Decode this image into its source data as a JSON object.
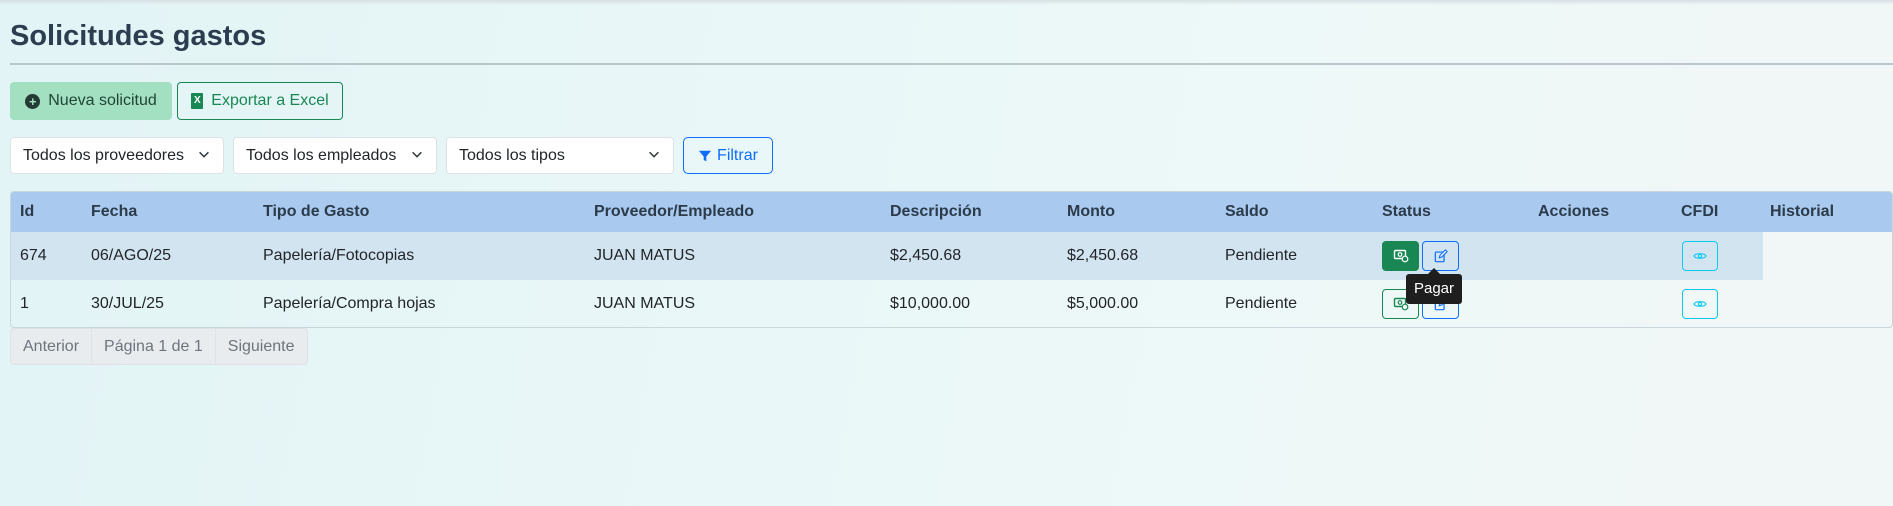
{
  "page": {
    "title": "Solicitudes gastos"
  },
  "toolbar": {
    "new_label": "Nueva solicitud",
    "export_label": "Exportar a Excel",
    "export_icon_text": "X"
  },
  "filters": {
    "proveedores": "Todos los proveedores",
    "empleados": "Todos los empleados",
    "tipos": "Todos los tipos",
    "filter_label": "Filtrar"
  },
  "table": {
    "headers": {
      "id": "Id",
      "fecha": "Fecha",
      "tipo": "Tipo de Gasto",
      "proveedor": "Proveedor/Empleado",
      "descripcion": "Descripción",
      "monto": "Monto",
      "saldo": "Saldo",
      "status": "Status",
      "acciones": "Acciones",
      "cfdi": "CFDI",
      "historial": "Historial"
    },
    "rows": [
      {
        "id": "674",
        "fecha": "06/AGO/25",
        "tipo": "Papelería/Fotocopias",
        "proveedor": "JUAN MATUS",
        "descripcion": "$2,450.68",
        "monto": "$2,450.68",
        "saldo": "Pendiente"
      },
      {
        "id": "1",
        "fecha": "30/JUL/25",
        "tipo": "Papelería/Compra hojas",
        "proveedor": "JUAN MATUS",
        "descripcion": "$10,000.00",
        "monto": "$5,000.00",
        "saldo": "Pendiente"
      }
    ]
  },
  "tooltip": {
    "label": "Pagar"
  },
  "pagination": {
    "prev": "Anterior",
    "page_info": "Página 1 de 1",
    "next": "Siguiente"
  },
  "colors": {
    "header_bg": "#a9c9ef",
    "highlight_row": "#d3e4f1",
    "success": "#198754",
    "primary": "#0d6efd",
    "info": "#0dcaf0"
  },
  "icons": {
    "new": "plus-circle-icon",
    "export": "excel-file-icon",
    "filter": "funnel-icon",
    "select": "chevron-down-icon",
    "pay": "cash-pay-icon",
    "edit": "edit-pencil-icon",
    "cfdi": "eye-icon"
  }
}
